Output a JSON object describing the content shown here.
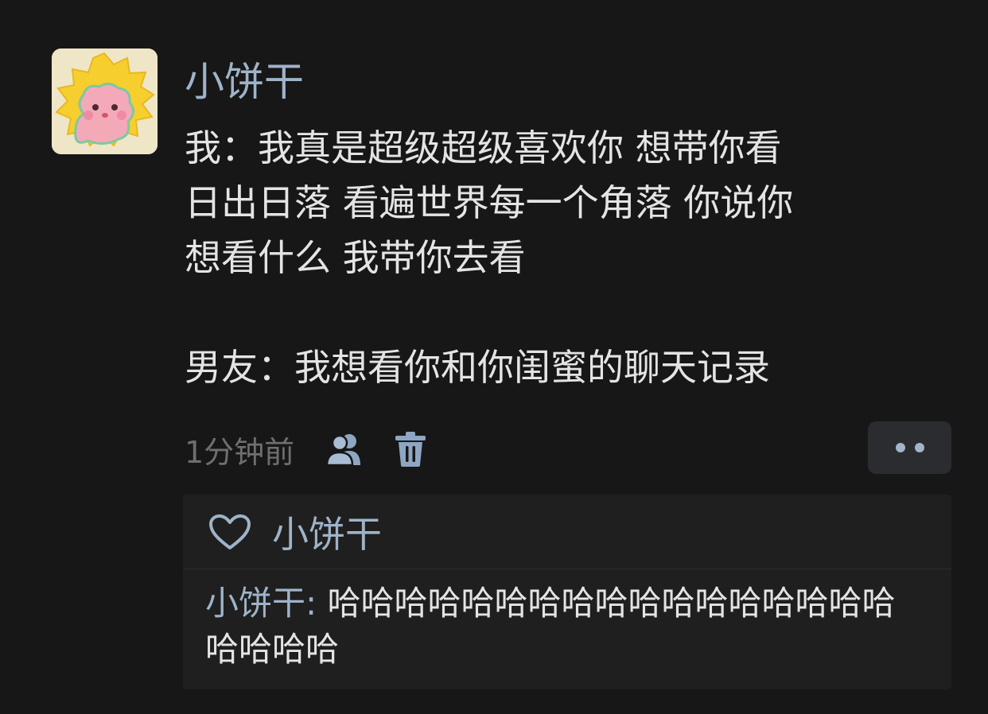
{
  "post": {
    "username": "小饼干",
    "lines": [
      "我：我真是超级超级喜欢你 想带你看",
      "日出日落 看遍世界每一个角落 你说你",
      "想看什么 我带你去看"
    ],
    "reply_line": "男友：我想看你和你闺蜜的聊天记录",
    "timestamp": "1分钟前"
  },
  "icons": {
    "avatar": "avatar-cartoon-icon",
    "share": "people-icon",
    "delete": "trash-icon",
    "more": "more-dots-icon",
    "like": "heart-icon"
  },
  "likes": {
    "names": "小饼干"
  },
  "comment": {
    "author": "小饼干",
    "separator": ": ",
    "text": "哈哈哈哈哈哈哈哈哈哈哈哈哈哈哈哈哈哈哈哈哈"
  },
  "colors": {
    "background": "#171717",
    "accent": "#9fb3c8",
    "text": "#e4e4e4",
    "muted": "#6f6f6f",
    "panel": "#1f1f1f"
  }
}
